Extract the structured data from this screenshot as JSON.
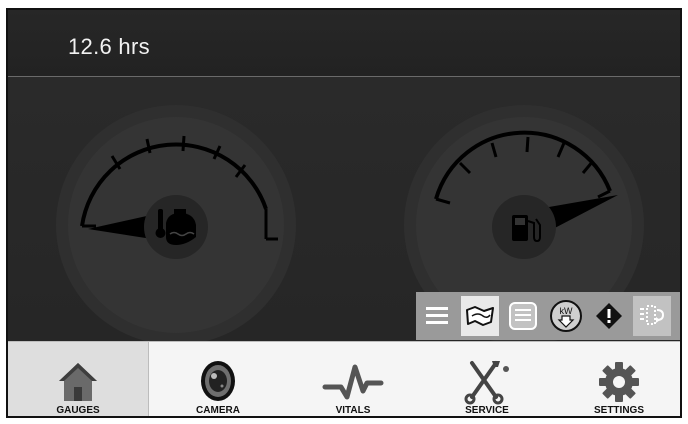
{
  "header": {
    "engine_hours": "12.6 hrs"
  },
  "gauges": [
    {
      "name": "coolant-temperature",
      "icon": "coolant-temperature-icon"
    },
    {
      "name": "fuel-level",
      "icon": "fuel-pump-icon"
    }
  ],
  "tray": {
    "buttons": [
      {
        "name": "menu",
        "icon": "menu-icon"
      },
      {
        "name": "map",
        "icon": "map-icon"
      },
      {
        "name": "notes",
        "icon": "notes-icon"
      },
      {
        "name": "kw",
        "icon": "kw-down-icon",
        "label": "kW"
      },
      {
        "name": "warning",
        "icon": "warning-icon"
      },
      {
        "name": "regen",
        "icon": "regen-icon"
      }
    ]
  },
  "nav": {
    "items": [
      {
        "id": "gauges",
        "label": "GAUGES",
        "active": true
      },
      {
        "id": "camera",
        "label": "CAMERA",
        "active": false
      },
      {
        "id": "vitals",
        "label": "VITALS",
        "active": false
      },
      {
        "id": "service",
        "label": "SERVICE",
        "active": false
      },
      {
        "id": "settings",
        "label": "SETTINGS",
        "active": false
      }
    ]
  },
  "colors": {
    "background": "#1c1c1c",
    "gauge_face": "#333333",
    "tray": "#9a9a9a",
    "nav_bar": "#f5f5f5"
  }
}
